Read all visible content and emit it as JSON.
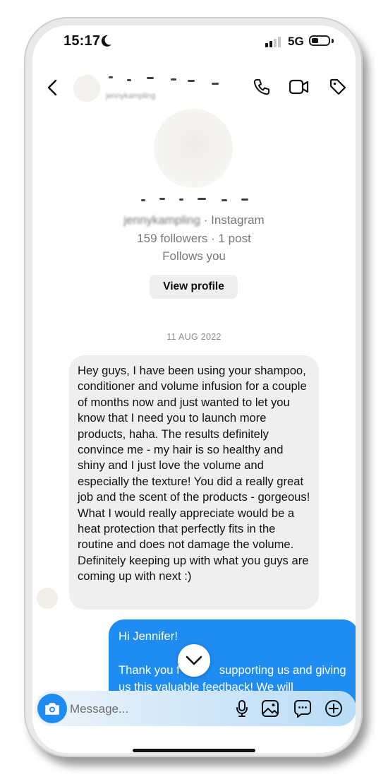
{
  "status_bar": {
    "time": "15:17",
    "network": "5G",
    "signal_bars_active": 2,
    "signal_bars_total": 4,
    "battery_level": 0.3
  },
  "header": {
    "back_icon": "chevron-left-icon",
    "handle_small": "jennykampling",
    "actions": [
      "phone-icon",
      "video-camera-icon",
      "tag-icon"
    ]
  },
  "profile": {
    "handle": "jennykampling",
    "platform": " · Instagram",
    "followers": "159 followers · 1 post",
    "follows_you": "Follows you",
    "view_profile_label": "View profile"
  },
  "thread": {
    "date": "11 AUG 2022",
    "incoming_message": "Hey guys, I have been using your shampoo, conditioner and volume infusion for a couple of months now and just wanted to let you know that I need you to launch more products, haha. The results definitely convince me - my hair is so healthy and shiny and I just love the volume and especially the texture! You did a really great job and the scent of the products - gorgeous! What I would really appreciate would be a heat protection that perfectly fits in the routine and does not damage the volume. Definitely keeping up with what you guys are coming up with next :)",
    "outgoing_greeting": "Hi Jennifer!",
    "outgoing_body_start": "Thank you f",
    "outgoing_body_mid": "supporting us and giving",
    "outgoing_body_line2": "us this valuable feedback! We will"
  },
  "composer": {
    "placeholder": "Message...",
    "icons": [
      "camera-icon",
      "microphone-icon",
      "gallery-icon",
      "sticker-icon",
      "plus-icon"
    ]
  },
  "colors": {
    "accent": "#1f8cf2",
    "incoming_bubble": "#efefef",
    "muted_text": "#777777"
  }
}
